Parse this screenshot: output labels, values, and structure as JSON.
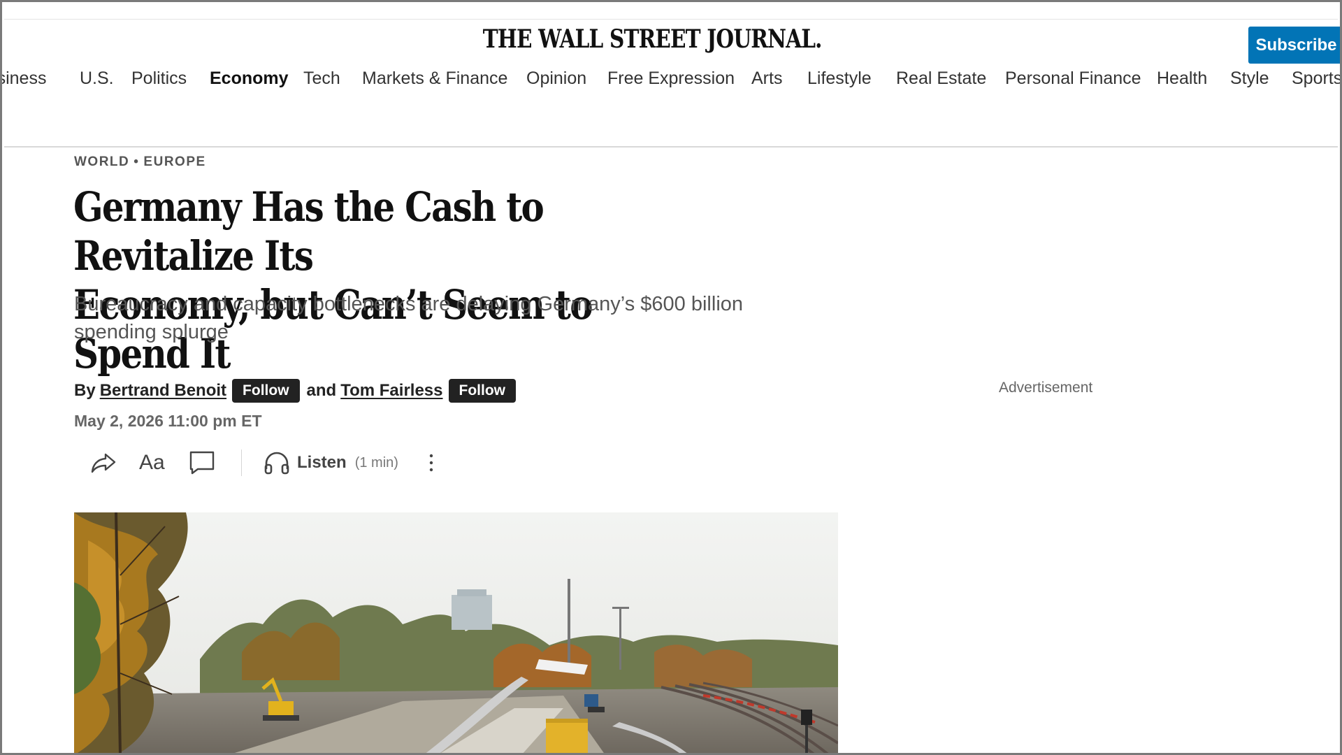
{
  "header": {
    "masthead": "THE WALL STREET JOURNAL.",
    "subscribe_label": "Subscribe"
  },
  "nav": {
    "items": [
      {
        "label": "Business",
        "active": false
      },
      {
        "label": "U.S.",
        "active": false
      },
      {
        "label": "Politics",
        "active": false
      },
      {
        "label": "Economy",
        "active": true
      },
      {
        "label": "Tech",
        "active": false
      },
      {
        "label": "Markets & Finance",
        "active": false
      },
      {
        "label": "Opinion",
        "active": false
      },
      {
        "label": "Free Expression",
        "active": false
      },
      {
        "label": "Arts",
        "active": false
      },
      {
        "label": "Lifestyle",
        "active": false
      },
      {
        "label": "Real Estate",
        "active": false
      },
      {
        "label": "Personal Finance",
        "active": false
      },
      {
        "label": "Health",
        "active": false
      },
      {
        "label": "Style",
        "active": false
      },
      {
        "label": "Sports",
        "active": false
      }
    ]
  },
  "article": {
    "section": "WORLD",
    "subsection": "EUROPE",
    "separator": "•",
    "headline_line1": "Germany Has the Cash to Revitalize Its",
    "headline_line2": "Economy, but Can’t Seem to Spend It",
    "dek": "Bureaucracy and capacity bottlenecks are delaying Germany’s $600 billion spending splurge",
    "byline": {
      "by": "By",
      "author1": "Bertrand Benoit",
      "and": "and",
      "author2": "Tom Fairless",
      "follow_label": "Follow"
    },
    "timestamp": "May 2, 2026 11:00 pm ET",
    "toolbar": {
      "share_icon": "share-icon",
      "text_size_label": "Aa",
      "comments_icon": "comment-icon",
      "listen_icon": "headphones-icon",
      "listen_label": "Listen",
      "listen_duration": "(1 min)",
      "more_icon": "more-vertical-icon"
    }
  },
  "sidebar": {
    "ad_label": "Advertisement"
  },
  "colors": {
    "subscribe_bg": "#0274b6",
    "follow_bg": "#222222",
    "text": "#111111",
    "muted": "#555555"
  }
}
